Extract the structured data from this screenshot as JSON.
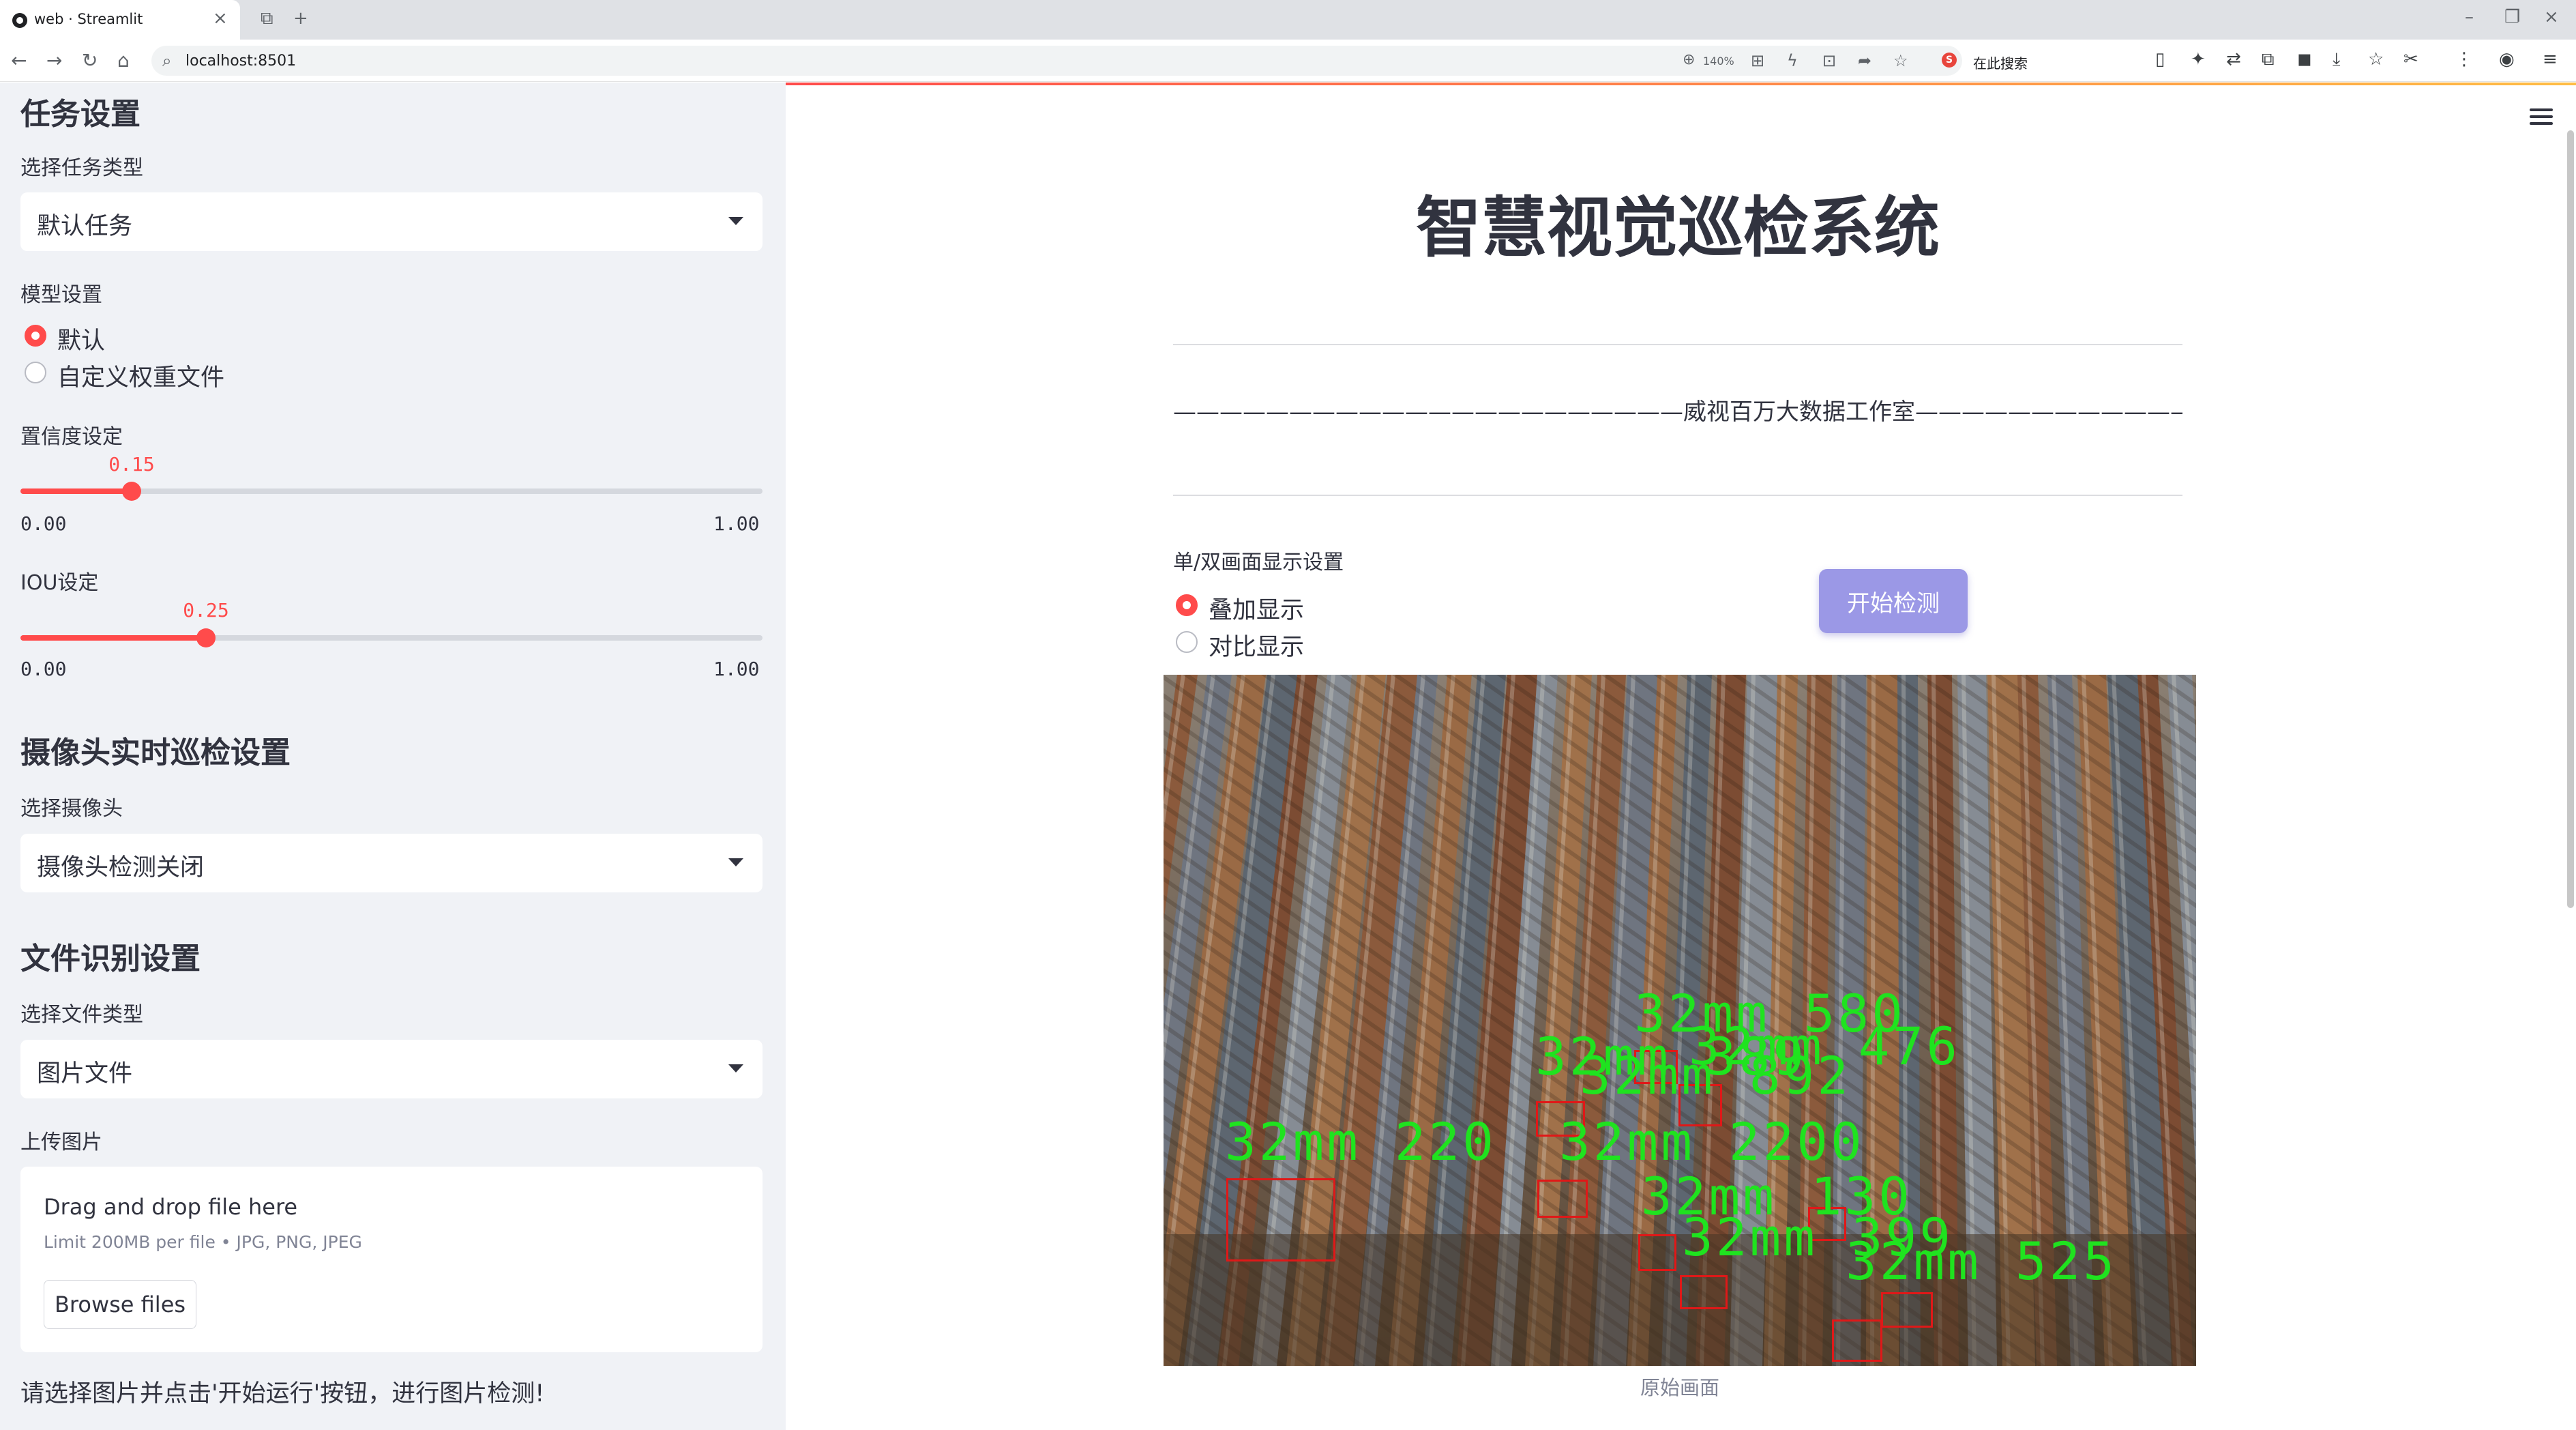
{
  "browser": {
    "tab_title": "web · Streamlit",
    "url": "localhost:8501",
    "zoom": "140%",
    "search_engine_text": "在此搜索"
  },
  "sidebar": {
    "task_section_title": "任务设置",
    "task_type_label": "选择任务类型",
    "task_type_value": "默认任务",
    "model_label": "模型设置",
    "model_options": [
      "默认",
      "自定义权重文件"
    ],
    "model_selected": "默认",
    "confidence": {
      "label": "置信度设定",
      "value": "0.15",
      "value_num": 0.15,
      "min": "0.00",
      "max": "1.00"
    },
    "iou": {
      "label": "IOU设定",
      "value": "0.25",
      "value_num": 0.25,
      "min": "0.00",
      "max": "1.00"
    },
    "camera_section_title": "摄像头实时巡检设置",
    "camera_label": "选择摄像头",
    "camera_value": "摄像头检测关闭",
    "file_section_title": "文件识别设置",
    "file_type_label": "选择文件类型",
    "file_type_value": "图片文件",
    "upload_label": "上传图片",
    "upload": {
      "title": "Drag and drop file here",
      "limit": "Limit 200MB per file • JPG, PNG, JPEG",
      "button": "Browse files"
    },
    "hint": "请选择图片并点击'开始运行'按钮，进行图片检测!"
  },
  "main": {
    "title": "智慧视觉巡检系统",
    "studio_line": "——————————————————————威视百万大数据工作室——————————————————————",
    "display_label": "单/双画面显示设置",
    "display_options": [
      "叠加显示",
      "对比显示"
    ],
    "display_selected": "叠加显示",
    "start_button": "开始检测",
    "caption": "原始画面",
    "detection_labels": [
      "32mm 580",
      "32mm 476",
      "32mm 389",
      "32mm 892",
      "32mm 220",
      "32mm 2200",
      "32mm 130",
      "32mm 399",
      "32mm 525"
    ]
  },
  "colors": {
    "accent": "#ff4b4b",
    "sidebar_bg": "#f0f2f6",
    "button_bg": "#9b98e6",
    "detection_box": "#e01818",
    "detection_text": "#1fe31f"
  }
}
